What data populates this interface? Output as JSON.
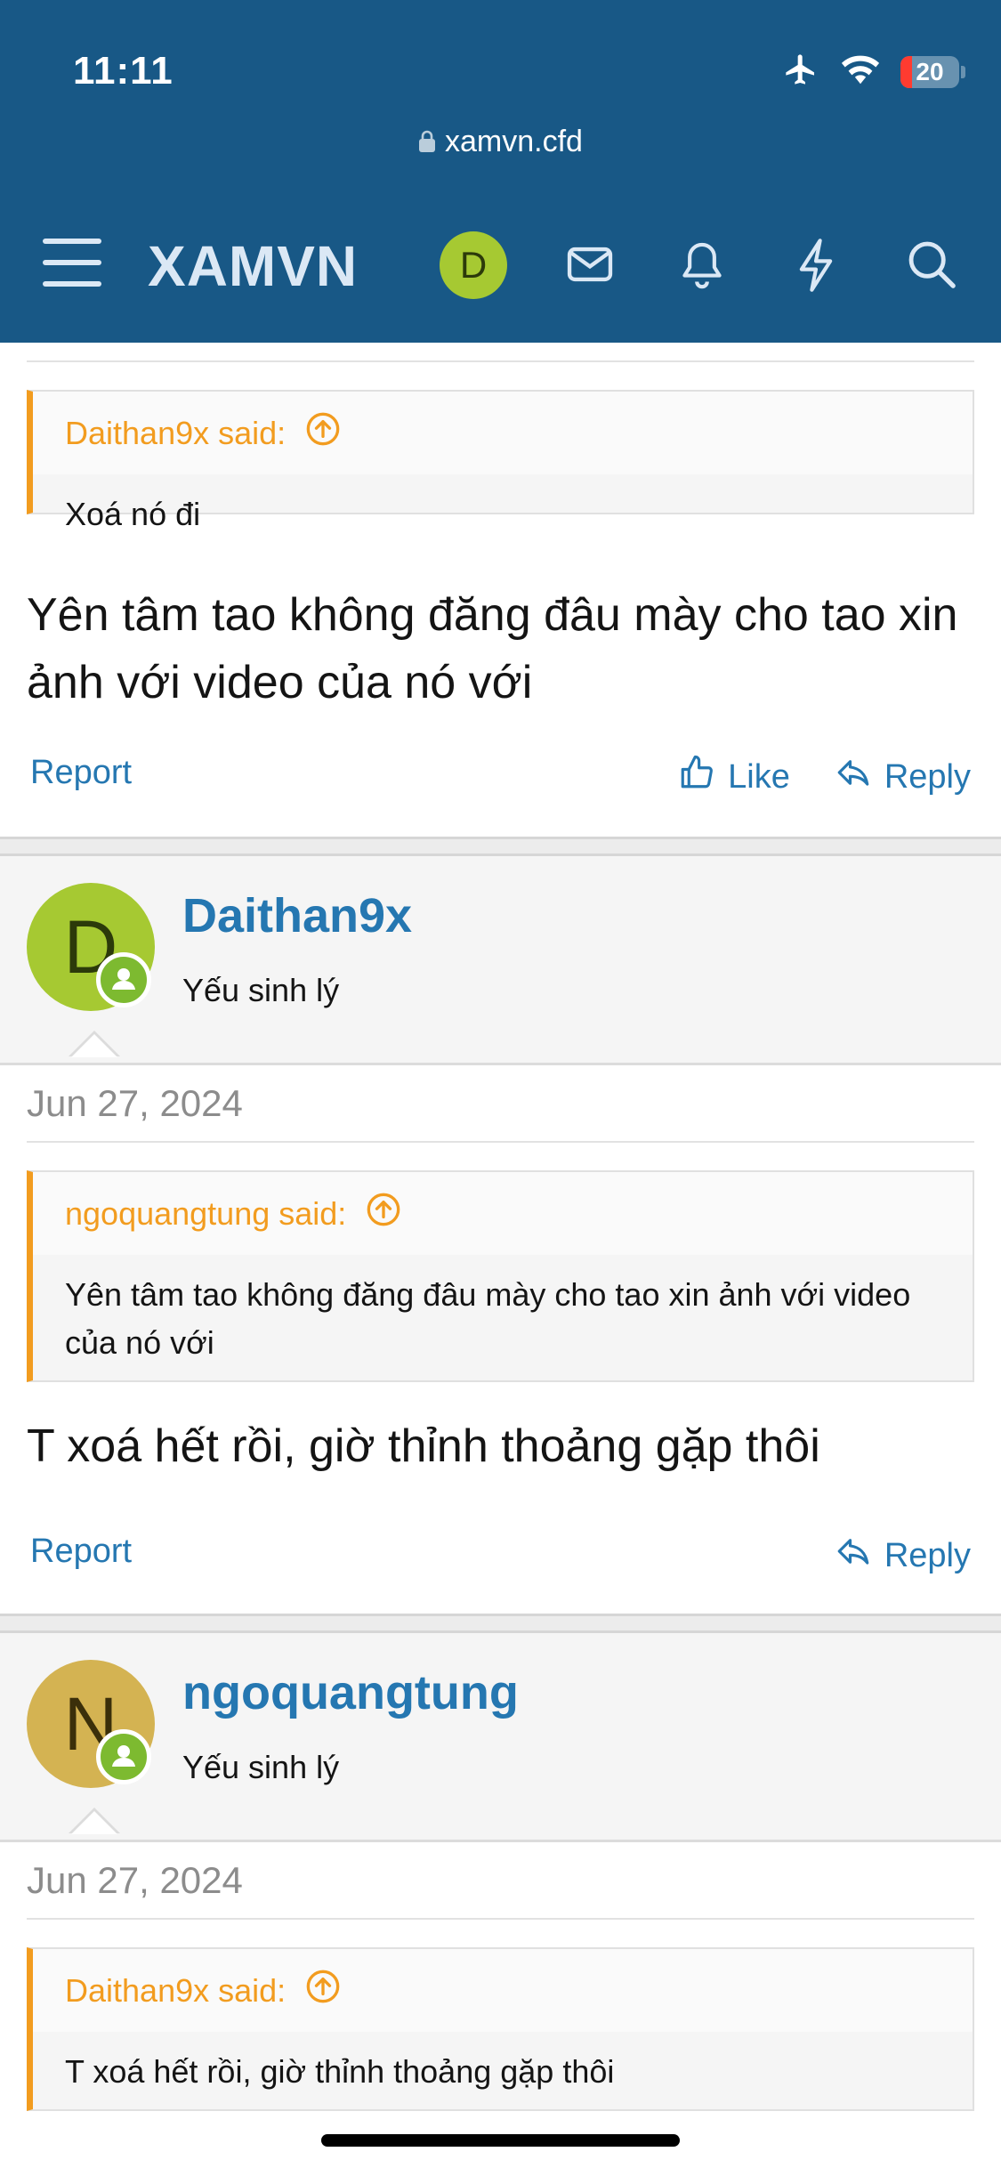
{
  "status": {
    "time": "11:11",
    "battery": "20"
  },
  "browser": {
    "url": "xamvn.cfd"
  },
  "nav": {
    "logo": "XAMVN",
    "avatar_letter": "D"
  },
  "colors": {
    "header_bg": "#185886",
    "link": "#2577b1",
    "quote_accent": "#f29c1f",
    "online_badge": "#7dba30",
    "avatar_daithan": "#a6c932",
    "avatar_ngoquangtung": "#d4b352"
  },
  "posts": [
    {
      "quote": {
        "author": "Daithan9x said:",
        "text": "Xoá nó đi"
      },
      "message": "Yên tâm tao không đăng đâu mày cho tao xin ảnh với video của nó với",
      "actions": {
        "report": "Report",
        "like": "Like",
        "reply": "Reply"
      }
    },
    {
      "user": {
        "avatar_letter": "D",
        "name": "Daithan9x",
        "title": "Yếu sinh lý"
      },
      "date": "Jun 27, 2024",
      "quote": {
        "author": "ngoquangtung said:",
        "text": "Yên tâm tao không đăng đâu mày cho tao xin ảnh với video của nó với"
      },
      "message": "T xoá hết rồi, giờ thỉnh thoảng gặp thôi",
      "actions": {
        "report": "Report",
        "reply": "Reply"
      }
    },
    {
      "user": {
        "avatar_letter": "N",
        "name": "ngoquangtung",
        "title": "Yếu sinh lý"
      },
      "date": "Jun 27, 2024",
      "quote": {
        "author": "Daithan9x said:",
        "text": "T xoá hết rồi, giờ thỉnh thoảng gặp thôi"
      }
    }
  ]
}
